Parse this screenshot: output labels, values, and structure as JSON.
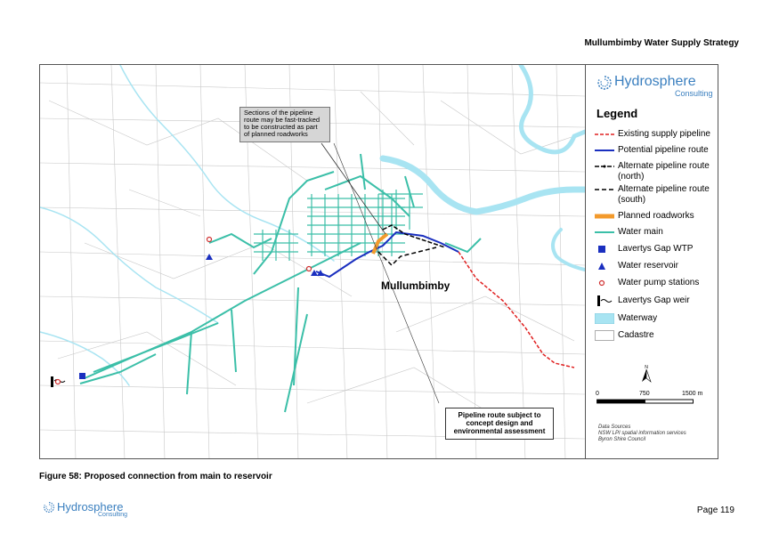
{
  "header": {
    "title": "Mullumbimby Water Supply Strategy"
  },
  "logo": {
    "name": "Hydrosphere",
    "sub": "Consulting"
  },
  "legend": {
    "heading": "Legend",
    "items": [
      {
        "label": "Existing supply pipeline",
        "color": "#e02020"
      },
      {
        "label": "Potential pipeline route",
        "color": "#1a2fbf"
      },
      {
        "label": "Alternate pipeline route (north)",
        "color": "#000000"
      },
      {
        "label": "Alternate pipeline route (south)",
        "color": "#000000"
      },
      {
        "label": "Planned roadworks",
        "color": "#f39a2c"
      },
      {
        "label": "Water main",
        "color": "#3bbfa8"
      },
      {
        "label": "Lavertys Gap WTP",
        "color": "#1a2fbf"
      },
      {
        "label": "Water reservoir",
        "color": "#1a2fbf"
      },
      {
        "label": "Water pump stations",
        "color": "#d03030"
      },
      {
        "label": "Lavertys Gap weir",
        "color": "#000000"
      },
      {
        "label": "Waterway",
        "color": "#a8e4f2"
      },
      {
        "label": "Cadastre",
        "color": "#bbbbbb"
      }
    ]
  },
  "scale": {
    "ticks": [
      "0",
      "750",
      "1500 m"
    ]
  },
  "data_sources": {
    "title": "Data Sources",
    "lines": [
      "NSW LPI spatial information services",
      "Byron Shire Council"
    ]
  },
  "map": {
    "callout": [
      "Sections of the pipeline",
      "route may be fast-tracked",
      "to be constructed as part",
      "of planned roadworks"
    ],
    "note": [
      "Pipeline route subject to",
      "concept design and",
      "environmental assessment"
    ],
    "place": "Mullumbimby"
  },
  "caption": "Figure 58: Proposed connection from main to reservoir",
  "footer": {
    "logo_name": "Hydrosphere",
    "logo_sub": "Consulting",
    "page": "Page 119"
  }
}
